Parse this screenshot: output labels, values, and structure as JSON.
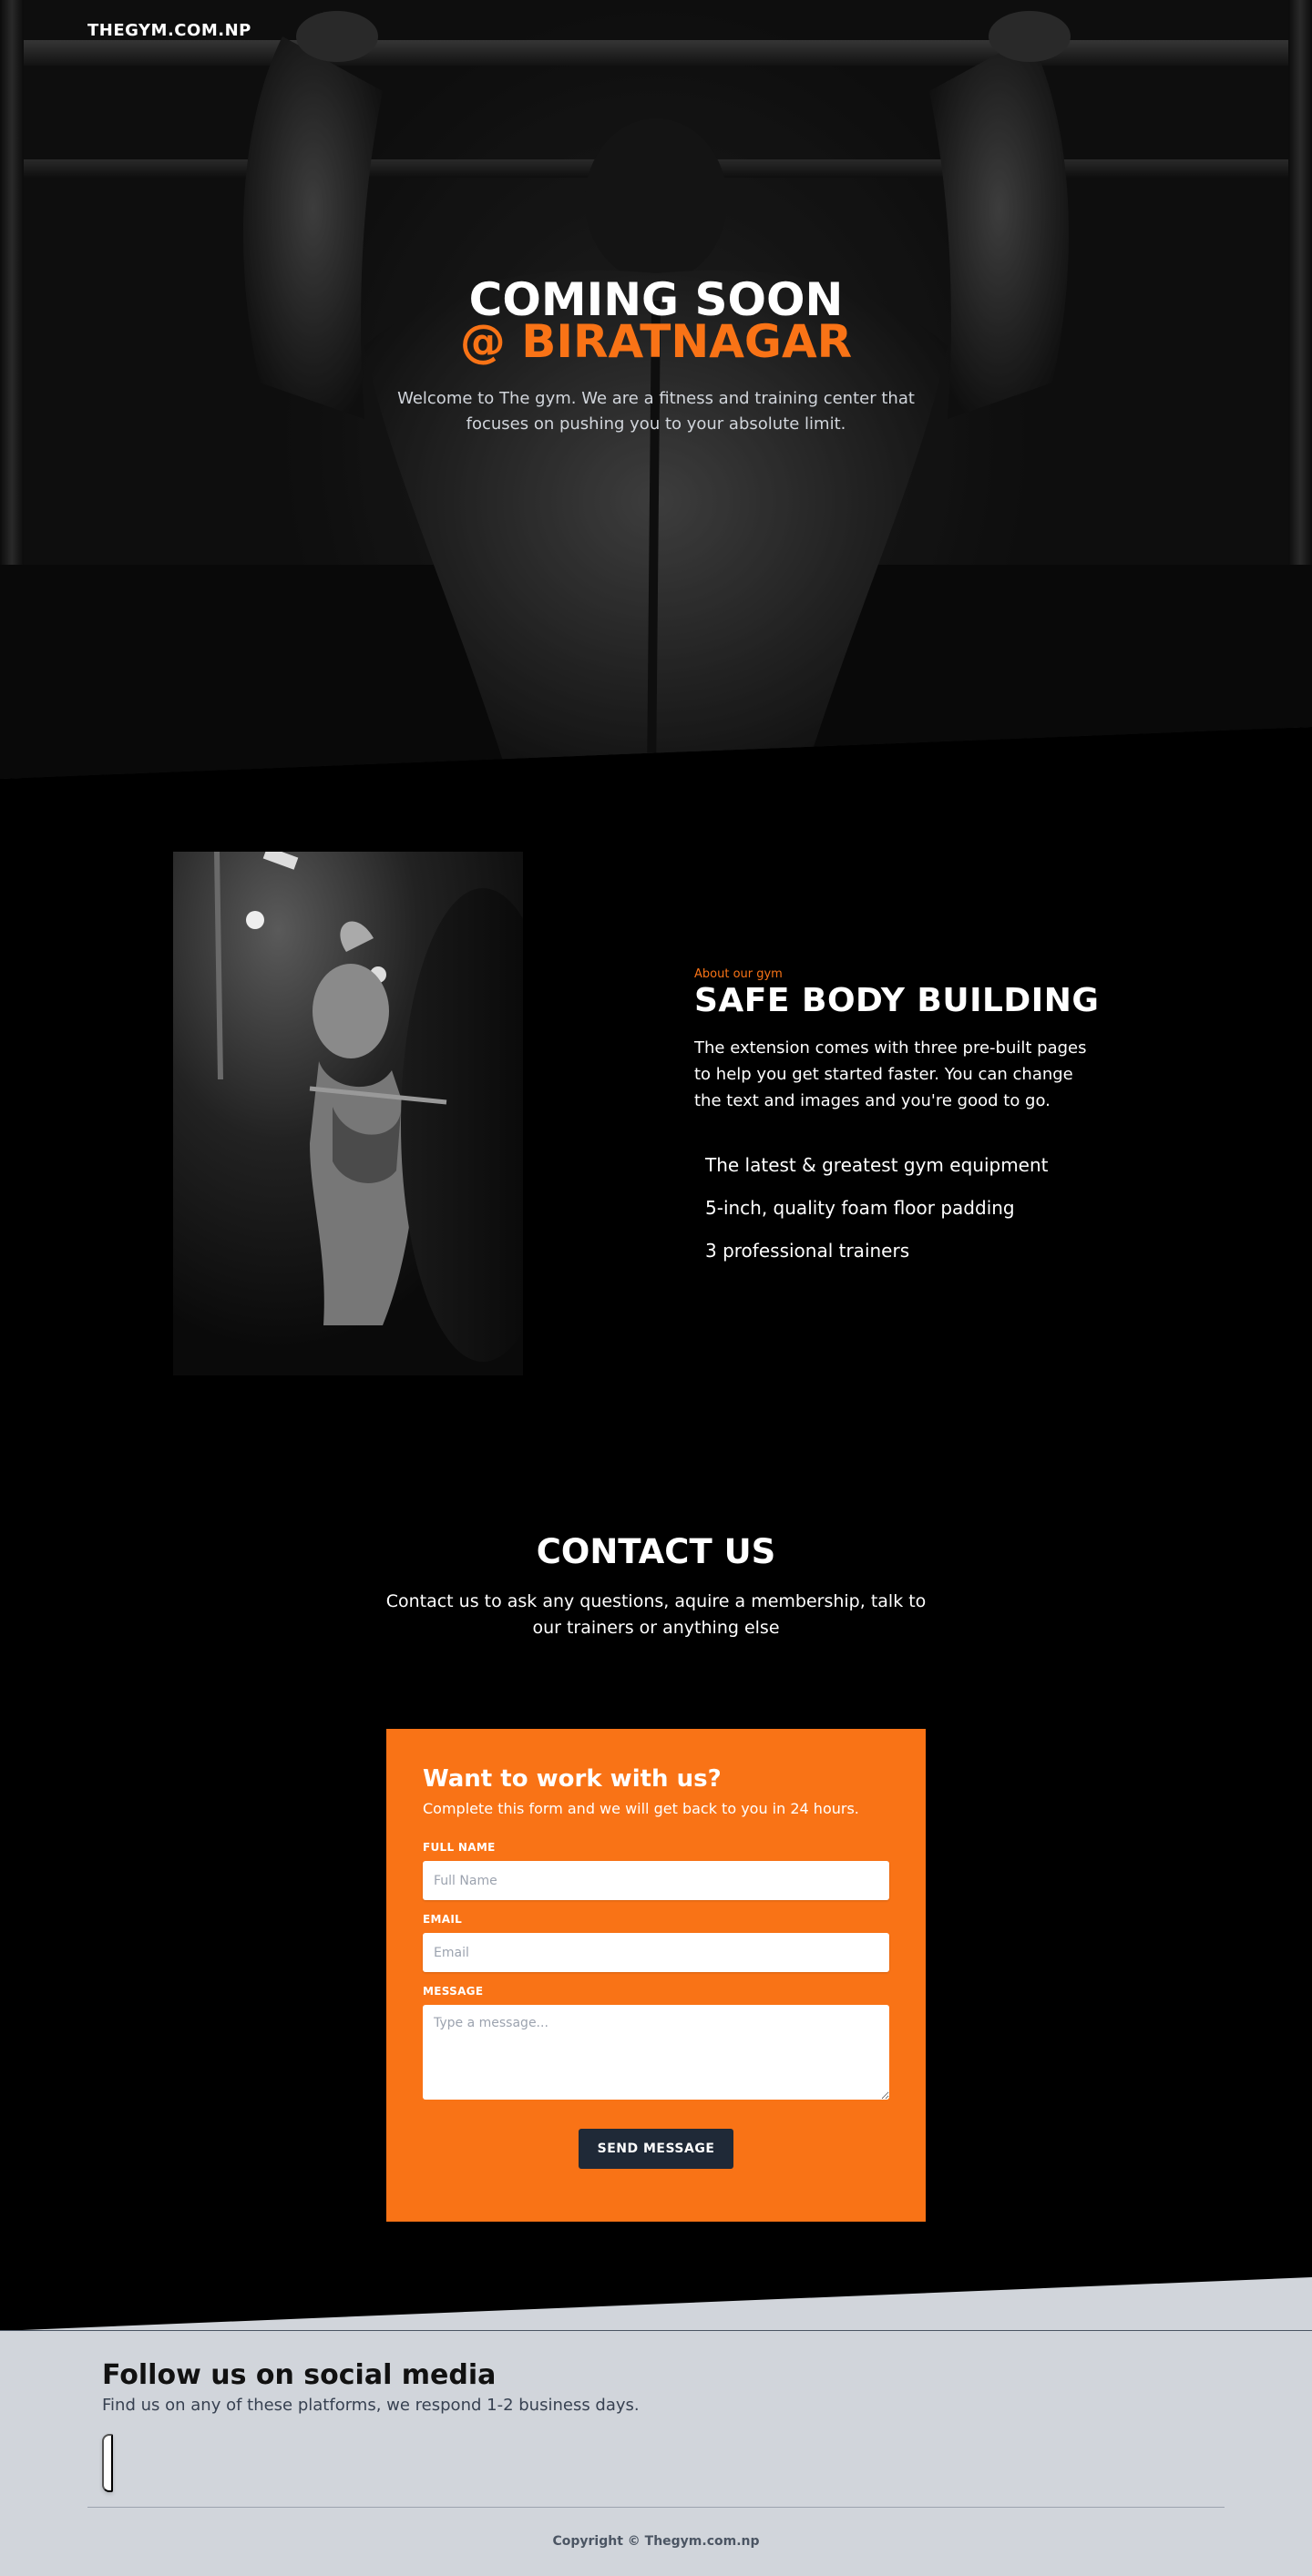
{
  "nav": {
    "brand": "THEGYM.COM.NP"
  },
  "hero": {
    "title": "COMING SOON",
    "subtitle": "@ BIRATNAGAR",
    "description": "Welcome to The gym. We are a fitness and training center that focuses on pushing you to your absolute limit."
  },
  "about": {
    "label": "About our gym",
    "title": "SAFE BODY BUILDING",
    "description": "The extension comes with three pre-built pages to help you get started faster. You can change the text and images and you're good to go.",
    "features": [
      "The latest & greatest gym equipment",
      "5-inch, quality foam floor padding",
      "3 professional trainers"
    ]
  },
  "contact": {
    "title": "CONTACT US",
    "description": "Contact us to ask any questions, aquire a membership, talk to our trainers or anything else",
    "form": {
      "title": "Want to work with us?",
      "subtitle": "Complete this form and we will get back to you in 24 hours.",
      "name_label": "FULL NAME",
      "name_placeholder": "Full Name",
      "email_label": "EMAIL",
      "email_placeholder": "Email",
      "message_label": "MESSAGE",
      "message_placeholder": "Type a message...",
      "submit_label": "SEND MESSAGE"
    }
  },
  "footer": {
    "social_title": "Follow us on social media",
    "social_description": "Find us on any of these platforms, we respond 1-2 business days.",
    "copyright": "Copyright © Thegym.com.np"
  },
  "colors": {
    "accent": "#f97316",
    "button_dark": "#1f2937",
    "footer_bg": "#d1d5db"
  }
}
